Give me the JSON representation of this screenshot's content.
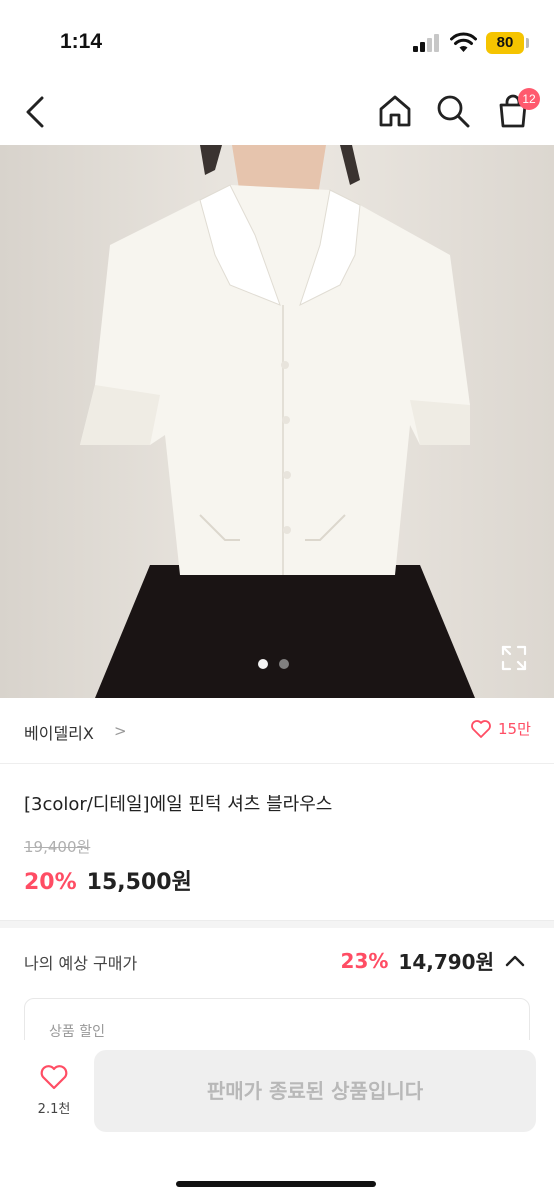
{
  "status_bar": {
    "time": "1:14",
    "battery": "80"
  },
  "header": {
    "cart_badge": "12"
  },
  "product": {
    "image_pages": 2,
    "current_page": 1,
    "shop_name": "베이델리X",
    "shop_chevron": ">",
    "likes": "15만",
    "title": "[3color/디테일]에일 핀턱 셔츠 블라우스",
    "original_price": "19,400원",
    "discount": "20%",
    "sale_price": "15,500원"
  },
  "expected": {
    "label": "나의 예상 구매가",
    "discount": "23%",
    "price": "14,790원",
    "benefit_label": "상품 할인"
  },
  "bottom": {
    "wish_count": "2.1천",
    "sold_out_label": "판매가 종료된 상품입니다"
  },
  "colors": {
    "accent": "#ff4d64",
    "badge": "#ff5a6e",
    "battery": "#f5c400"
  }
}
